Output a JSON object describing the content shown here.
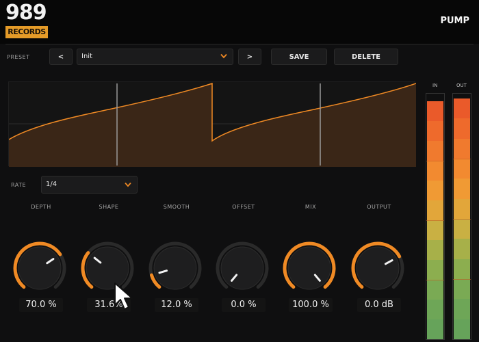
{
  "logo": {
    "top": "989",
    "bottom": "RECORDS"
  },
  "plugin_name": "PUMP",
  "preset": {
    "label": "PRESET",
    "prev": "<",
    "next": ">",
    "current": "Init",
    "save": "SAVE",
    "delete": "DELETE"
  },
  "rate": {
    "label": "RATE",
    "value": "1/4"
  },
  "knobs": [
    {
      "label": "DEPTH",
      "value": "70.0 %",
      "level": 0.7
    },
    {
      "label": "SHAPE",
      "value": "31.6%",
      "level": 0.316
    },
    {
      "label": "SMOOTH",
      "value": "12.0 %",
      "level": 0.12
    },
    {
      "label": "OFFSET",
      "value": "0.0 %",
      "level": 0.0
    },
    {
      "label": "MIX",
      "value": "100.0 %",
      "level": 1.0
    },
    {
      "label": "OUTPUT",
      "value": "0.0 dB",
      "level": 0.72
    }
  ],
  "meters": {
    "in_label": "IN",
    "out_label": "OUT",
    "in_level": 0.97,
    "out_level": 0.98
  },
  "colors": {
    "accent": "#f08a24",
    "wave_fill": "#3a2617",
    "knob_body": "#1e1e1f",
    "knob_track": "#2a2a2a"
  }
}
